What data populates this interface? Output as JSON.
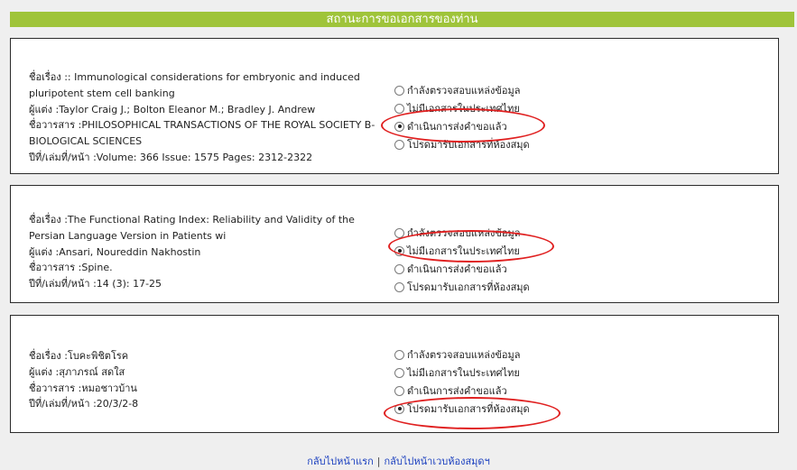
{
  "header": {
    "title": "สถานะการขอเอกสารของท่าน"
  },
  "records": [
    {
      "meta": [
        "ชื่อเรื่อง :: Immunological considerations for embryonic and induced pluripotent stem cell banking",
        "ผู้แต่ง :Taylor Craig J.; Bolton Eleanor M.; Bradley J. Andrew",
        "ชื่อวารสาร :PHILOSOPHICAL TRANSACTIONS OF THE ROYAL SOCIETY B-BIOLOGICAL SCIENCES",
        "ปีที่/เล่มที่/หน้า :Volume: 366 Issue: 1575 Pages: 2312-2322"
      ],
      "selected_index": 2
    },
    {
      "meta": [
        "ชื่อเรื่อง :The Functional Rating Index: Reliability and Validity of the Persian Language Version in Patients wi",
        "ผู้แต่ง :Ansari, Noureddin Nakhostin",
        "ชื่อวารสาร :Spine.",
        "ปีที่/เล่มที่/หน้า :14 (3): 17-25"
      ],
      "selected_index": 1
    },
    {
      "meta": [
        "ชื่อเรื่อง :โบคะพิชิตโรค",
        "ผู้แต่ง :สุภาภรณ์ สดใส",
        "ชื่อวารสาร :หมอชาวบ้าน",
        "ปีที่/เล่มที่/หน้า :20/3/2-8"
      ],
      "selected_index": 3
    }
  ],
  "status_options": [
    "กำลังตรวจสอบแหล่งข้อมูล",
    "ไม่มีเอกสารในประเทศไทย",
    "ดำเนินการส่งคำขอแล้ว",
    "โปรดมารับเอกสารที่ห้องสมุด"
  ],
  "footer": {
    "link_home": "กลับไปหน้าแรก",
    "separator": "|",
    "link_library": "กลับไปหน้าเวบห้องสมุดฯ"
  },
  "colors": {
    "header_bg": "#9fc43a",
    "highlight": "#e02020",
    "link": "#1a3fbf"
  }
}
